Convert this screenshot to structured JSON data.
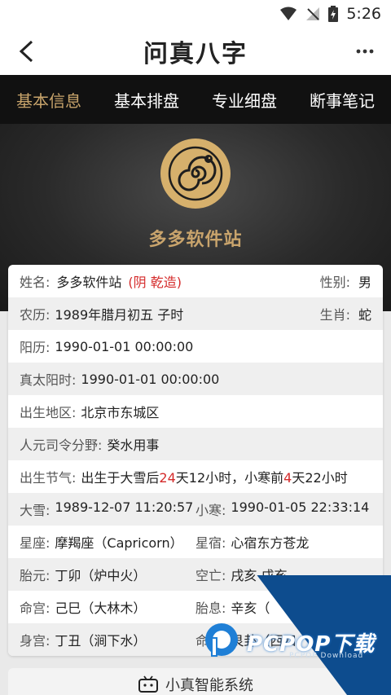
{
  "status": {
    "time": "5:26"
  },
  "header": {
    "title": "问真八字"
  },
  "tabs": [
    {
      "label": "基本信息",
      "active": true
    },
    {
      "label": "基本排盘"
    },
    {
      "label": "专业细盘"
    },
    {
      "label": "断事笔记"
    }
  ],
  "profile": {
    "name": "多多软件站"
  },
  "info": {
    "name_label": "姓名:",
    "name_value": "多多软件站",
    "name_tag": "(阴 乾造)",
    "gender_label": "性别:",
    "gender_value": "男",
    "lunar_label": "农历:",
    "lunar_value": "1989年腊月初五 子时",
    "zodiac_label": "生肖:",
    "zodiac_value": "蛇",
    "solar_label": "阳历:",
    "solar_value": "1990-01-01 00:00:00",
    "true_solar_label": "真太阳时:",
    "true_solar_value": "1990-01-01 00:00:00",
    "birthplace_label": "出生地区:",
    "birthplace_value": "北京市东城区",
    "renyuan_label": "人元司令分野:",
    "renyuan_value": "癸水用事",
    "jieqi_label": "出生节气:",
    "jieqi_p1": "出生于大雪后",
    "jieqi_n1": "24",
    "jieqi_p2": "天12小时，小寒前",
    "jieqi_n2": "4",
    "jieqi_p3": "天22小时",
    "daxue_label": "大雪:",
    "daxue_value": "1989-12-07 11:20:57",
    "xiaohan_label": "小寒:",
    "xiaohan_value": "1990-01-05 22:33:14",
    "star_label": "星座:",
    "star_value": "摩羯座（Capricorn）",
    "xingxiu_label": "星宿:",
    "xingxiu_value": "心宿东方苍龙",
    "taiyuan_label": "胎元:",
    "taiyuan_value": "丁卯（炉中火）",
    "kongwang_label": "空亡:",
    "kongwang_value": "戌亥 戌亥",
    "minggong_label": "命宫:",
    "minggong_value": "己巳（大林木）",
    "taixi_label": "胎息:",
    "taixi_value": "辛亥（",
    "shengong_label": "身宫:",
    "shengong_value": "丁丑（涧下水）",
    "minggua_label": "命卦:",
    "minggua_value": "艮卦（西四"
  },
  "bottom": {
    "label": "小真智能系统"
  },
  "watermark": {
    "brand": "PCPOP下载",
    "sub": "PCPOP Download"
  },
  "colors": {
    "accent_gold": "#c8a46b",
    "highlight_red": "#d42a2a",
    "tab_bg": "#111111"
  }
}
